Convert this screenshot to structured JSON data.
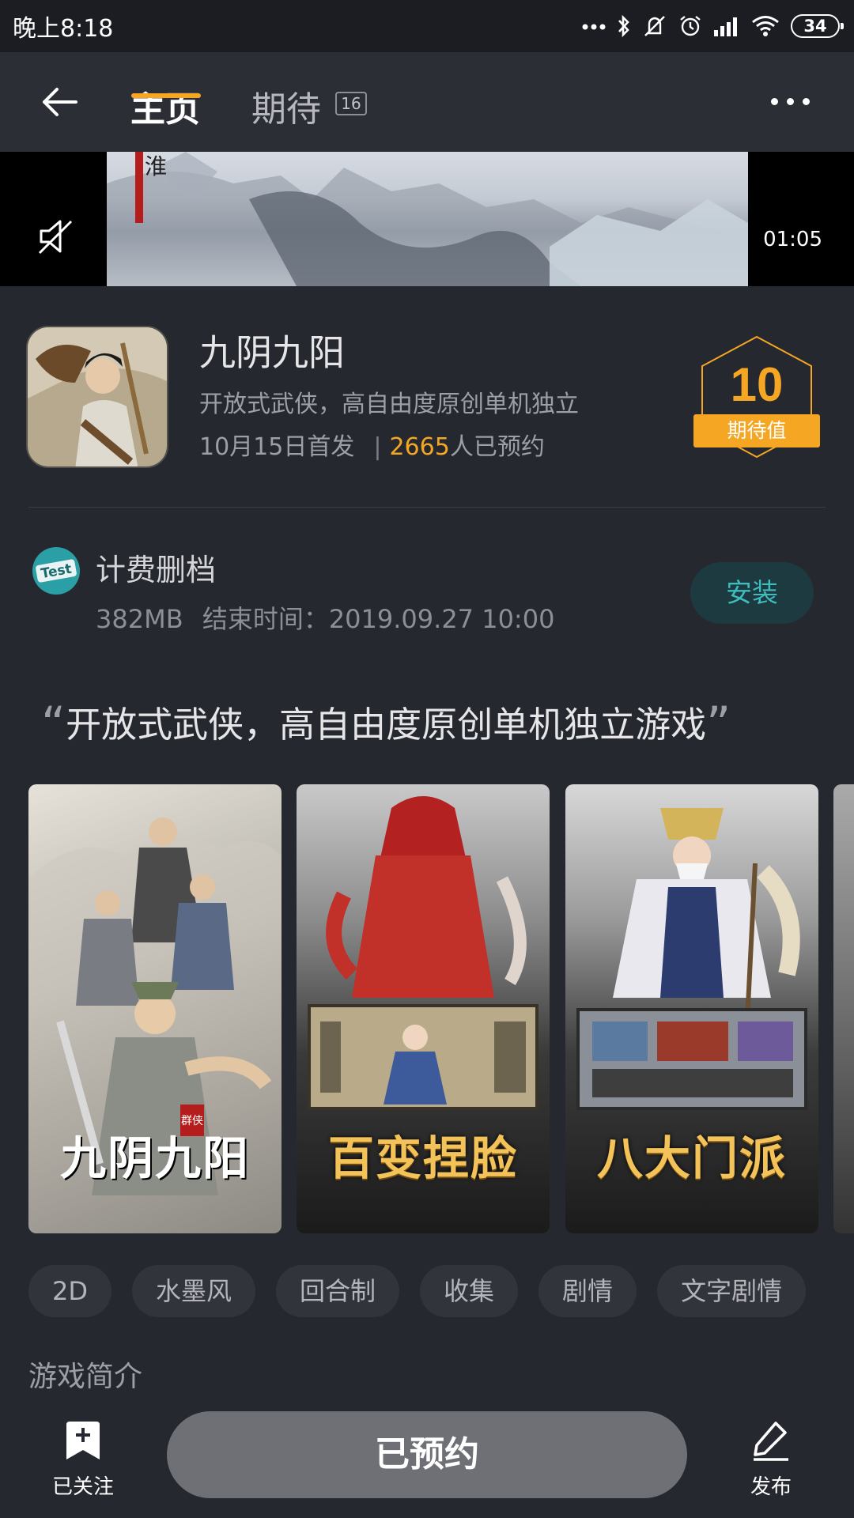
{
  "status_bar": {
    "time": "晚上8:18",
    "battery": "34",
    "icons": [
      "more-dots-icon",
      "bluetooth-icon",
      "mute-vibrate-icon",
      "alarm-icon",
      "signal-icon",
      "wifi-icon",
      "battery-icon"
    ]
  },
  "nav": {
    "tabs": [
      {
        "label": "主页",
        "active": true
      },
      {
        "label": "期待",
        "badge": "16"
      }
    ],
    "accent": "#f5a623"
  },
  "video": {
    "time": "01:05",
    "calligraphy": "淮"
  },
  "game": {
    "title": "九阴九阳",
    "tagline": "开放式武侠，高自由度原创单机独立",
    "release": "10月15日首发",
    "separator": "|",
    "reservations": "2665",
    "reservations_suffix": "人已预约",
    "score": "10",
    "score_label": "期待值"
  },
  "test": {
    "icon_text": "Test",
    "title": "计费删档",
    "size": "382MB",
    "end_time": "结束时间：2019.09.27 10:00",
    "install_label": "安装"
  },
  "quote": {
    "open": "“",
    "text": "开放式武侠，高自由度原创单机独立游戏",
    "close": "”"
  },
  "screenshots": [
    {
      "caption": "九阴九阳",
      "stamp": "群侠"
    },
    {
      "caption": "百变捏脸"
    },
    {
      "caption": "八大门派"
    }
  ],
  "tags": [
    "2D",
    "水墨风",
    "回合制",
    "收集",
    "剧情",
    "文字剧情"
  ],
  "intro_title": "游戏简介",
  "bottom": {
    "follow_label": "已关注",
    "reserve_label": "已预约",
    "publish_label": "发布"
  }
}
